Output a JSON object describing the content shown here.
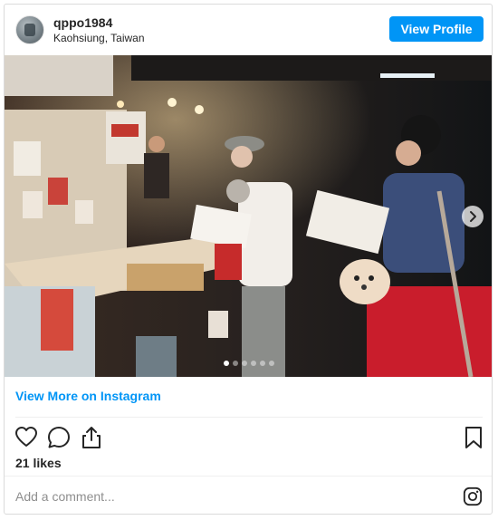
{
  "post": {
    "username": "qppo1984",
    "location": "Kaohsiung, Taiwan",
    "view_profile_label": "View Profile",
    "view_more_label": "View More on Instagram",
    "likes_text": "21 likes",
    "comment_placeholder": "Add a comment...",
    "carousel": {
      "total_slides": 6,
      "active_slide": 1
    }
  },
  "icons": {
    "like": "heart-icon",
    "comment": "speech-bubble-icon",
    "share": "share-icon",
    "save": "bookmark-icon",
    "next": "chevron-right-icon",
    "brand": "instagram-icon"
  },
  "colors": {
    "accent": "#0095f6",
    "text": "#262626",
    "muted": "#8e8e8e",
    "border": "#dbdbdb"
  }
}
